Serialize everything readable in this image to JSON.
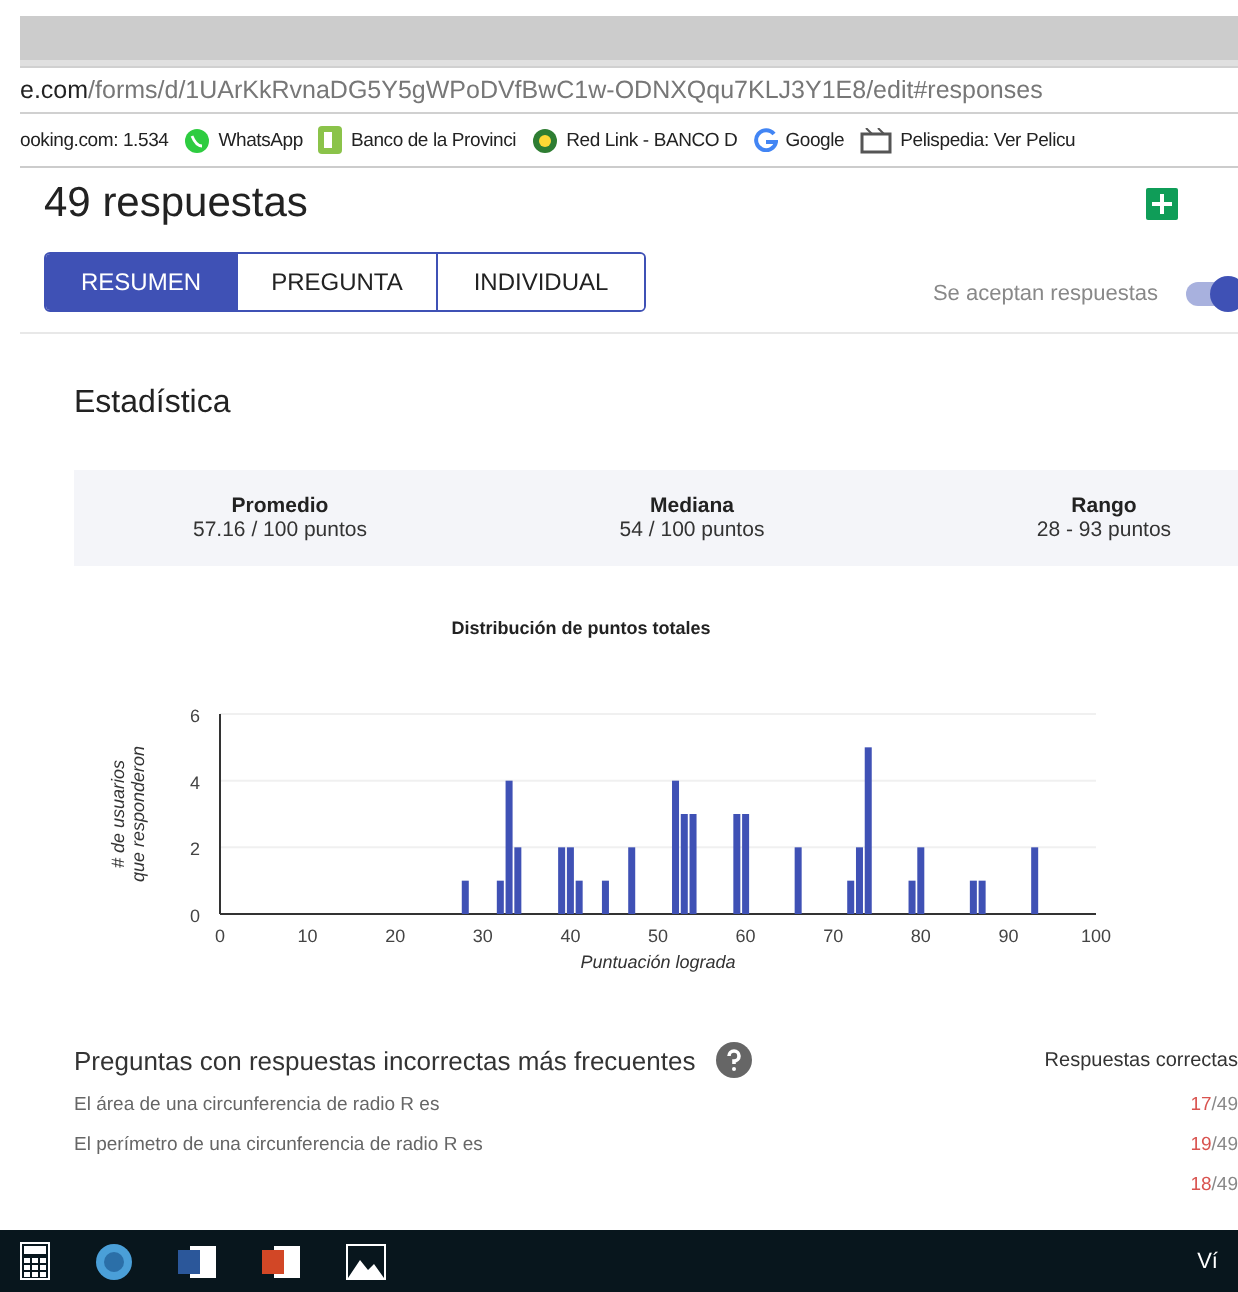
{
  "browser": {
    "address": {
      "host": "e.com",
      "path": "/forms/d/1UArKkRvnaDG5Y5gWPoDVfBwC1w-ODNXQqu7KLJ3Y1E8/edit#responses"
    },
    "bookmarks": [
      {
        "kind": "plain",
        "label": "ooking.com: 1.534"
      },
      {
        "kind": "whatsapp",
        "label": "WhatsApp"
      },
      {
        "kind": "bank",
        "label": "Banco de la Provinci"
      },
      {
        "kind": "link",
        "label": "Red Link - BANCO D"
      },
      {
        "kind": "google",
        "label": "Google"
      },
      {
        "kind": "film",
        "label": "Pelispedia: Ver Pelicu"
      }
    ]
  },
  "header": {
    "title": "49 respuestas"
  },
  "tabs": [
    {
      "label": "RESUMEN",
      "selected": true
    },
    {
      "label": "PREGUNTA",
      "selected": false
    },
    {
      "label": "INDIVIDUAL",
      "selected": false
    }
  ],
  "accepting": {
    "label": "Se aceptan respuestas",
    "on": true
  },
  "stats": {
    "title": "Estadística",
    "items": [
      {
        "label": "Promedio",
        "value": "57.16 / 100 puntos"
      },
      {
        "label": "Mediana",
        "value": "54 / 100 puntos"
      },
      {
        "label": "Rango",
        "value": "28 - 93 puntos"
      }
    ]
  },
  "chart_data": {
    "type": "bar",
    "title": "Distribución de puntos totales",
    "xlabel": "Puntuación lograda",
    "ylabel": "# de usuarios que responderon",
    "x": [
      28,
      32,
      33,
      34,
      39,
      40,
      41,
      44,
      47,
      52,
      53,
      54,
      59,
      60,
      66,
      72,
      73,
      74,
      79,
      80,
      86,
      87,
      93
    ],
    "series": [
      {
        "color": "#3f51b5",
        "values": [
          1,
          1,
          4,
          2,
          2,
          2,
          1,
          1,
          2,
          4,
          3,
          3,
          3,
          3,
          2,
          1,
          2,
          5,
          1,
          2,
          1,
          1,
          2
        ]
      }
    ],
    "xlim": [
      0,
      100
    ],
    "ylim": [
      0,
      6
    ],
    "xticks": [
      0,
      10,
      20,
      30,
      40,
      50,
      60,
      70,
      80,
      90,
      100
    ],
    "yticks": [
      0,
      2,
      4,
      6
    ]
  },
  "questions": {
    "title": "Preguntas con respuestas incorrectas más frecuentes",
    "column": "Respuestas correctas",
    "rows": [
      {
        "text": "El área de una circunferencia de radio R es",
        "correct": "17",
        "total": "/49"
      },
      {
        "text": "El perímetro de una circunferencia de radio R es",
        "correct": "19",
        "total": "/49"
      },
      {
        "correct": "18",
        "total": "/49"
      }
    ]
  },
  "taskbar": {
    "apps": [
      {
        "kind": "calculator"
      },
      {
        "kind": "disc"
      },
      {
        "kind": "word"
      },
      {
        "kind": "powerpoint"
      },
      {
        "kind": "photos"
      }
    ],
    "tray": "Ví"
  }
}
